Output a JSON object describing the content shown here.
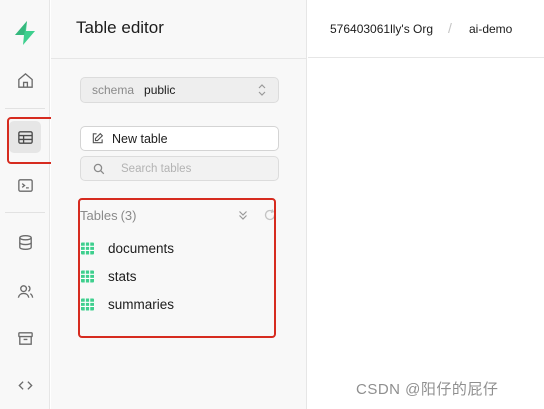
{
  "app": {
    "logo": "supabase-logo",
    "accent": "#3ecf8e"
  },
  "rail": {
    "items": [
      {
        "name": "home",
        "icon": "home-icon"
      },
      {
        "name": "table-editor",
        "icon": "table-icon",
        "active": true
      },
      {
        "name": "sql-editor",
        "icon": "terminal-icon"
      },
      {
        "name": "database",
        "icon": "database-icon"
      },
      {
        "name": "authentication",
        "icon": "users-icon"
      },
      {
        "name": "storage",
        "icon": "archive-icon"
      },
      {
        "name": "api-docs",
        "icon": "code-icon"
      }
    ]
  },
  "panel": {
    "title": "Table editor",
    "schema": {
      "label": "schema",
      "value": "public"
    },
    "new_table_label": "New table",
    "search_placeholder": "Search tables",
    "tables_heading": "Tables",
    "tables_count": "(3)",
    "tables": [
      {
        "name": "documents"
      },
      {
        "name": "stats"
      },
      {
        "name": "summaries"
      }
    ]
  },
  "breadcrumb": {
    "org": "576403061lly's Org",
    "separator": "/",
    "project": "ai-demo"
  },
  "watermark": "CSDN @阳仔的屁仔",
  "colors": {
    "annotation_red": "#d62b1f",
    "table_icon_green": "#3ecf8e"
  }
}
